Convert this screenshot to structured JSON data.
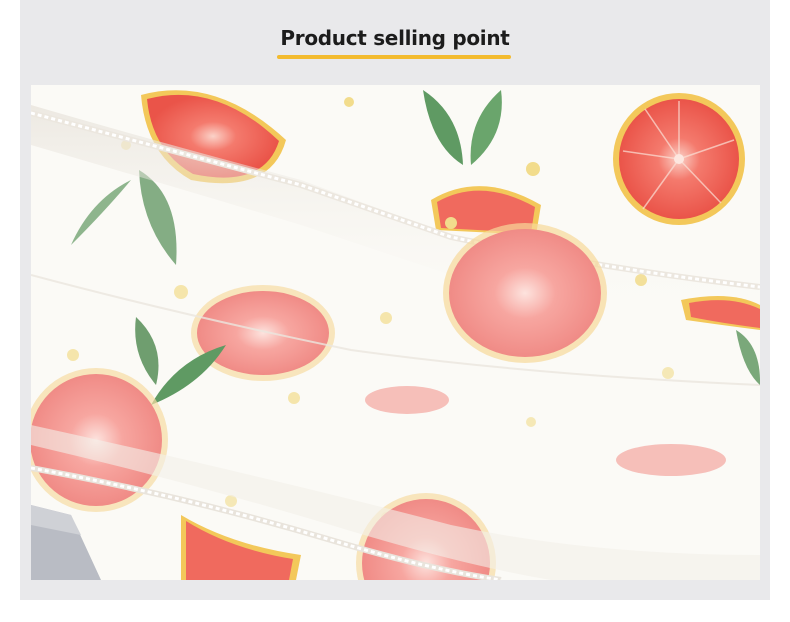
{
  "header": {
    "title": "Product selling point",
    "underline_color": "#f3bb2f"
  },
  "photo": {
    "subject": "grapefruit-print-fabric",
    "colors": {
      "fabric": "#fbfaf6",
      "grapefruit_flesh": "#f06a5e",
      "grapefruit_rind": "#f3c85a",
      "leaf": "#5f9a63",
      "dot": "#f2dc8c",
      "background": "#e9e9eb"
    }
  }
}
